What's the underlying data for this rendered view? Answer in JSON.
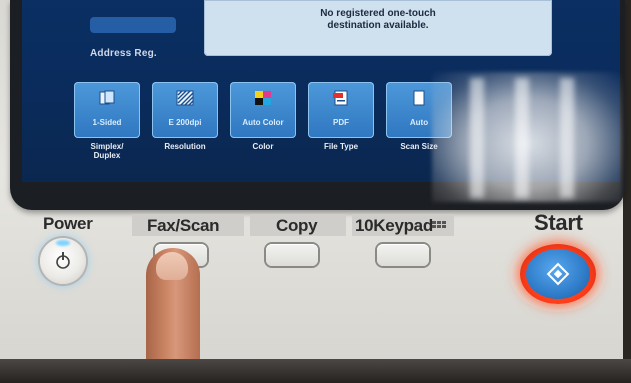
{
  "screen": {
    "address_label": "Address Reg.",
    "message": "No registered one-touch\ndestination available.",
    "buttons": [
      {
        "value": "1-Sided",
        "caption": "Simplex/\nDuplex",
        "icon": "duplex-icon"
      },
      {
        "value": "E 200dpi",
        "caption": "Resolution",
        "icon": "resolution-icon"
      },
      {
        "value": "Auto Color",
        "caption": "Color",
        "icon": "color-icon"
      },
      {
        "value": "PDF",
        "caption": "File Type",
        "icon": "pdf-icon"
      },
      {
        "value": "Auto",
        "caption": "Scan Size",
        "icon": "scan-size-icon"
      }
    ]
  },
  "panel": {
    "power_label": "Power",
    "fax_scan_label": "Fax/Scan",
    "copy_label": "Copy",
    "keypad_label": "10Keypad",
    "start_label": "Start"
  },
  "colors": {
    "screen_bg": "#0a2b5b",
    "screen_button": "#3b86cf",
    "start_ring": "#ff3d1a",
    "start_button": "#2f7cc9",
    "power_led": "#7fd3ff"
  }
}
